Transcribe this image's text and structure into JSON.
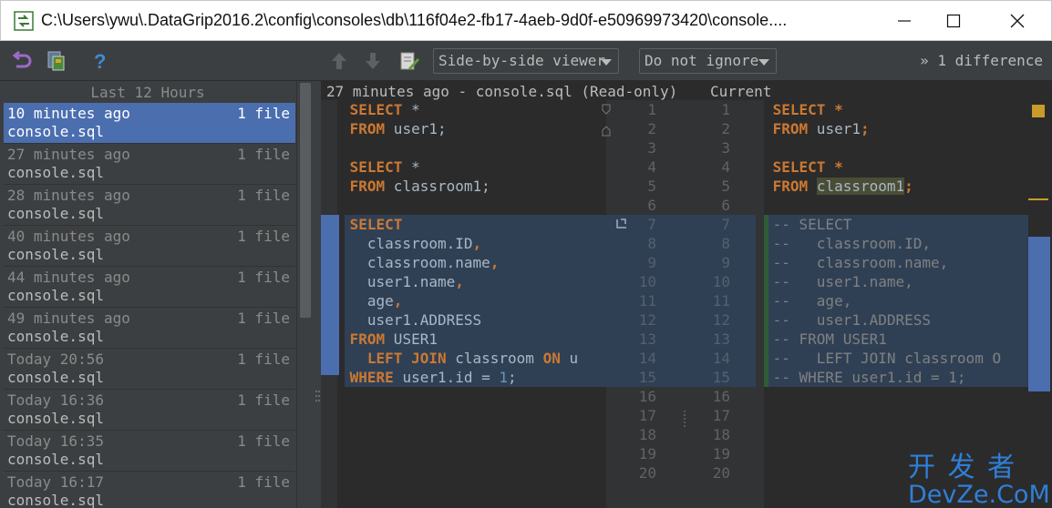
{
  "window": {
    "title": "C:\\Users\\ywu\\.DataGrip2016.2\\config\\consoles\\db\\116f04e2-fb17-4aeb-9d0f-e50969973420\\console...."
  },
  "toolbar": {
    "viewer_combo": "Side-by-side viewer",
    "ignore_combo": "Do not ignore",
    "difference_count": "1 difference",
    "difference_prefix": "»"
  },
  "sidebar": {
    "header": "Last 12 Hours",
    "items": [
      {
        "when": "10 minutes ago",
        "count": "1 file",
        "file": "console.sql"
      },
      {
        "when": "27 minutes ago",
        "count": "1 file",
        "file": "console.sql"
      },
      {
        "when": "28 minutes ago",
        "count": "1 file",
        "file": "console.sql"
      },
      {
        "when": "40 minutes ago",
        "count": "1 file",
        "file": "console.sql"
      },
      {
        "when": "44 minutes ago",
        "count": "1 file",
        "file": "console.sql"
      },
      {
        "when": "49 minutes ago",
        "count": "1 file",
        "file": "console.sql"
      },
      {
        "when": "Today 20:56",
        "count": "1 file",
        "file": "console.sql"
      },
      {
        "when": "Today 16:36",
        "count": "1 file",
        "file": "console.sql"
      },
      {
        "when": "Today 16:35",
        "count": "1 file",
        "file": "console.sql"
      },
      {
        "when": "Today 16:17",
        "count": "1 file",
        "file": "console.sql"
      }
    ]
  },
  "diff": {
    "left_header": "27 minutes ago - console.sql (Read-only)",
    "right_header": "Current",
    "line_numbers": [
      "1",
      "2",
      "3",
      "4",
      "5",
      "6",
      "7",
      "8",
      "9",
      "10",
      "11",
      "12",
      "13",
      "14",
      "15",
      "16",
      "17",
      "18",
      "19",
      "20"
    ]
  },
  "watermark": {
    "chinese": "开 发 者",
    "latin": "DevZe.CoM"
  },
  "colors": {
    "accent": "#4b6eaf",
    "keyword": "#cc7832",
    "number": "#6897bb",
    "comment": "#808080",
    "changed_block": "#2f4055",
    "background": "#2b2b2b"
  }
}
